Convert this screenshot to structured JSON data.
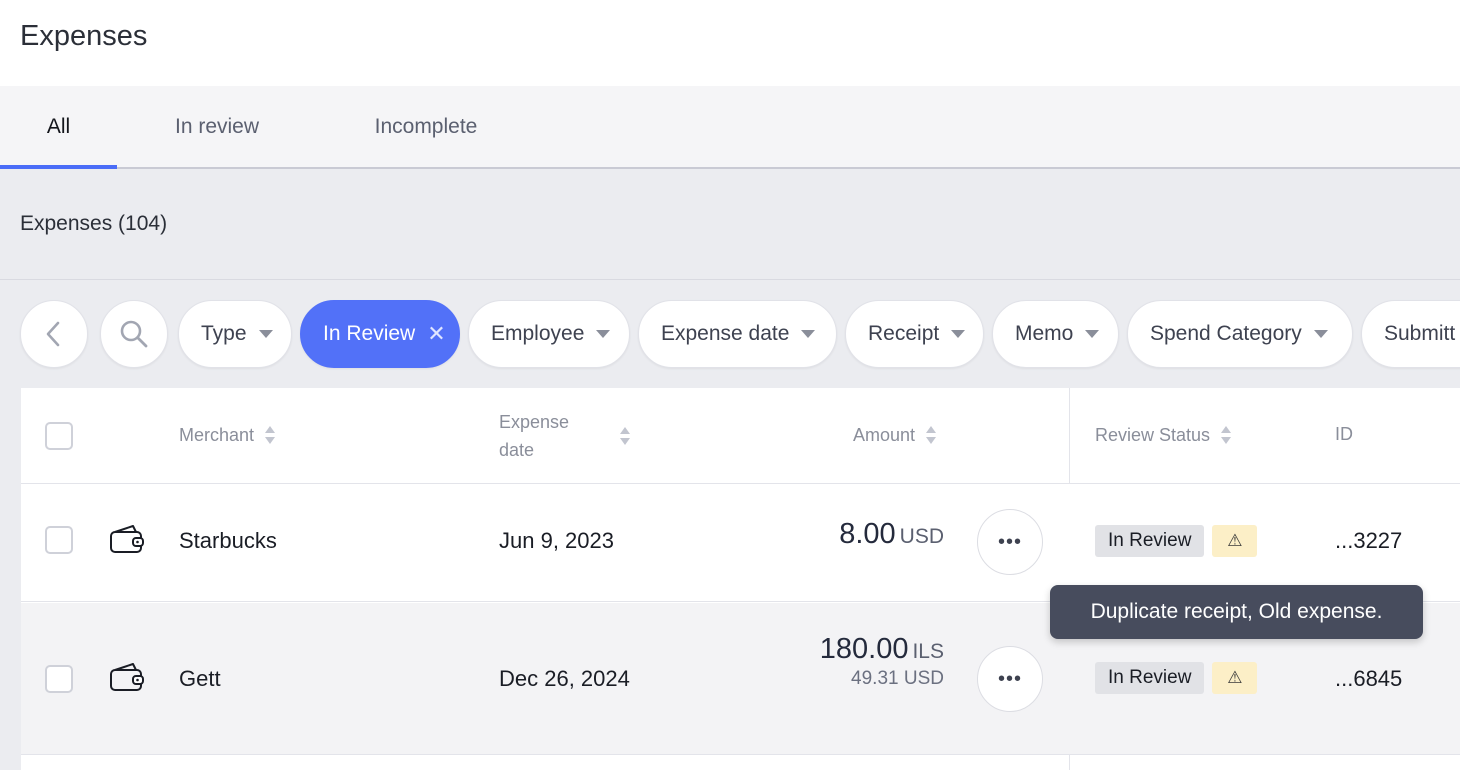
{
  "header": {
    "title": "Expenses"
  },
  "tabs": [
    {
      "label": "All",
      "active": true
    },
    {
      "label": "In review",
      "active": false
    },
    {
      "label": "Incomplete",
      "active": false
    }
  ],
  "section": {
    "count_label": "Expenses (104)"
  },
  "filters": {
    "back_icon": "chevron-left-icon",
    "search_icon": "search-icon",
    "chips": [
      {
        "label": "Type"
      },
      {
        "label": "In Review",
        "active": true
      },
      {
        "label": "Employee"
      },
      {
        "label": "Expense date"
      },
      {
        "label": "Receipt"
      },
      {
        "label": "Memo"
      },
      {
        "label": "Spend Category"
      },
      {
        "label": "Submitt"
      }
    ]
  },
  "table": {
    "columns": {
      "merchant": "Merchant",
      "expense_date_line1": "Expense",
      "expense_date_line2": "date",
      "amount": "Amount",
      "review_status": "Review Status",
      "id": "ID"
    },
    "rows": [
      {
        "icon": "wallet-icon",
        "merchant": "Starbucks",
        "date": "Jun 9, 2023",
        "amount": "8.00",
        "currency": "USD",
        "converted": "",
        "status": "In Review",
        "warning_icon": "⚠",
        "id": "...3227"
      },
      {
        "icon": "wallet-icon",
        "merchant": "Gett",
        "date": "Dec 26, 2024",
        "amount": "180.00",
        "currency": "ILS",
        "converted": "49.31 USD",
        "status": "In Review",
        "warning_icon": "⚠",
        "id": "...6845"
      }
    ]
  },
  "tooltip": {
    "text": "Duplicate receipt, Old expense."
  },
  "colors": {
    "accent": "#5271f8",
    "warning_bg": "#fcefc7",
    "tooltip_bg": "#474c5d"
  }
}
